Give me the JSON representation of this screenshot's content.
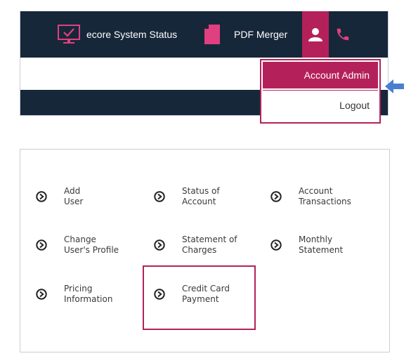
{
  "navbar": {
    "system_status_label": "ecore System Status",
    "pdf_merger_label": "PDF Merger",
    "icons": [
      "monitor-check-icon",
      "document-icon",
      "user-icon",
      "phone-icon"
    ]
  },
  "user_menu": {
    "items": [
      "Account Admin",
      "Logout"
    ]
  },
  "menu": {
    "items": [
      {
        "line1": "Add",
        "line2": "User"
      },
      {
        "line1": "Status of",
        "line2": "Account"
      },
      {
        "line1": "Account",
        "line2": "Transactions"
      },
      {
        "line1": "Change",
        "line2": "User's Profile"
      },
      {
        "line1": "Statement of",
        "line2": "Charges"
      },
      {
        "line1": "Monthly",
        "line2": "Statement"
      },
      {
        "line1": "Pricing",
        "line2": "Information"
      },
      {
        "line1": "Credit Card",
        "line2": "Payment"
      }
    ]
  },
  "colors": {
    "navbar_bg": "#17273a",
    "accent": "#b4215a",
    "pointer_arrow": "#4a7fd0"
  }
}
